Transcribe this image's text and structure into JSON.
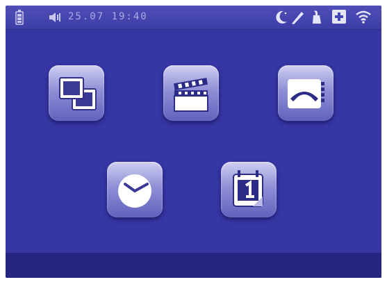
{
  "status_bar": {
    "datetime": "25.07  19:40",
    "left_icons": [
      "battery-icon",
      "speaker-volume-icon"
    ],
    "right_icons": [
      "night-mode-icon",
      "edit-icon",
      "intercom-handset-icon",
      "medical-cross-icon",
      "wifi-icon"
    ]
  },
  "apps": [
    {
      "id": "photo-gallery",
      "icon": "photos-icon"
    },
    {
      "id": "video",
      "icon": "clapperboard-icon"
    },
    {
      "id": "phonebook",
      "icon": "phone-handset-icon"
    },
    {
      "id": "clock",
      "icon": "clock-icon"
    },
    {
      "id": "calendar",
      "icon": "calendar-icon"
    }
  ],
  "colors": {
    "background": "#3636a4",
    "status_bar": "#4646b0",
    "bottom_bar": "#252582",
    "tile_light": "#cfcff2",
    "tile_dark": "#6161bd",
    "status_text": "#a9a9e6"
  }
}
